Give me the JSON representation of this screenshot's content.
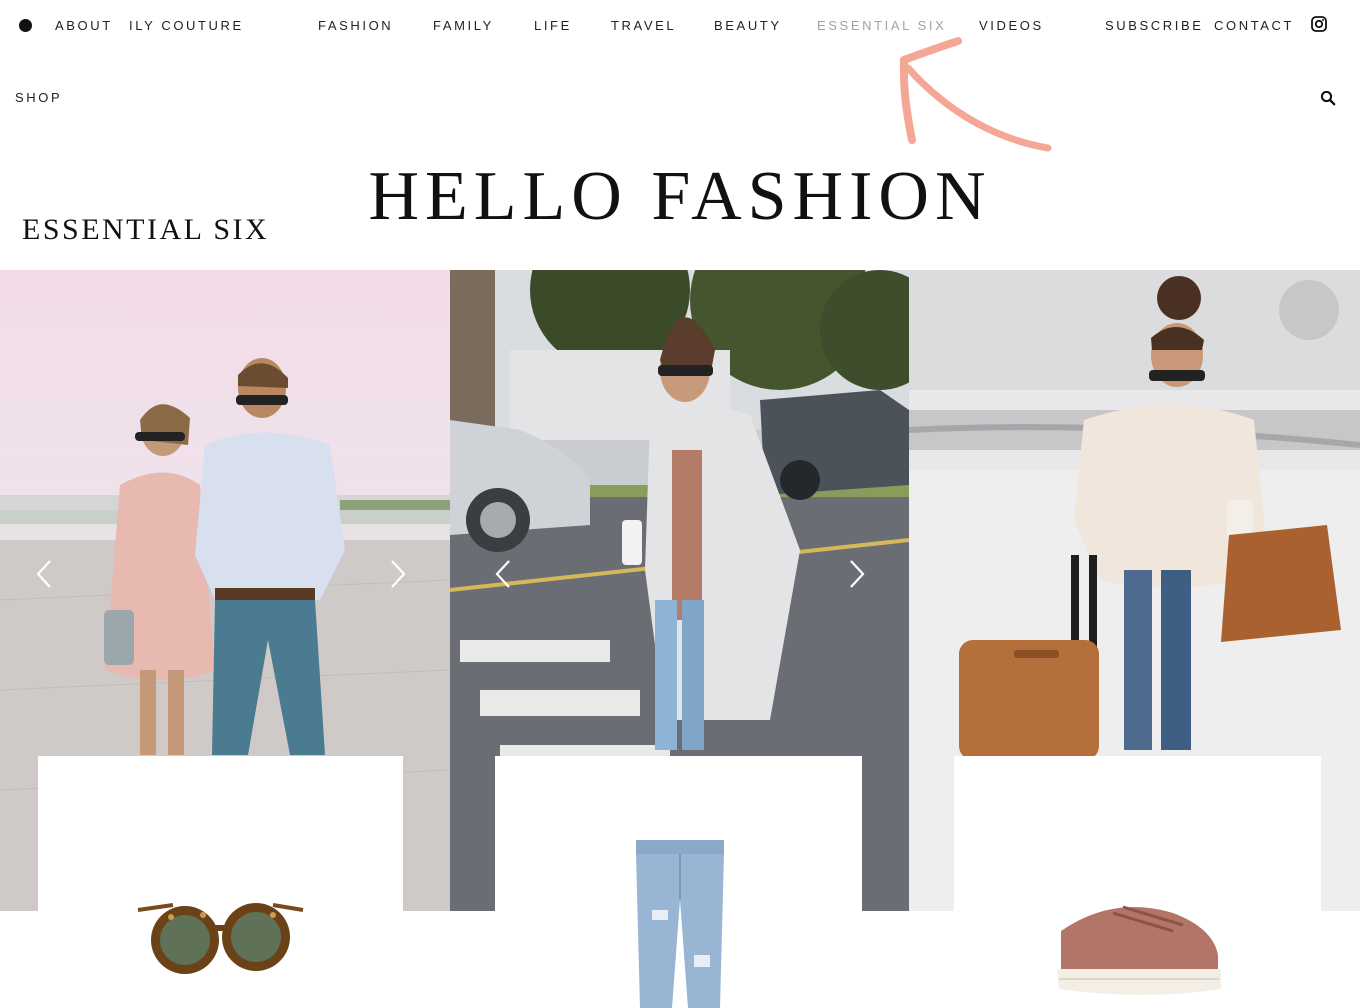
{
  "nav": {
    "left": [
      "ABOUT",
      "ILY COUTURE"
    ],
    "center": [
      "FASHION",
      "FAMILY",
      "LIFE",
      "TRAVEL",
      "BEAUTY",
      "ESSENTIAL SIX",
      "VIDEOS"
    ],
    "right": [
      "SUBSCRIBE",
      "CONTACT"
    ],
    "active": "ESSENTIAL SIX",
    "icons": [
      "logo-dot-icon",
      "instagram-icon"
    ]
  },
  "subnav": {
    "shop": "SHOP",
    "search_icon": "search-icon"
  },
  "brand": {
    "title": "HELLO FASHION"
  },
  "section": {
    "title": "ESSENTIAL SIX"
  },
  "annotation": {
    "icon": "pink-arrow-icon",
    "color": "#f4a795"
  },
  "gallery": {
    "panels": [
      "couple-outfit-photo",
      "street-cardigan-photo",
      "snow-travel-photo"
    ],
    "prev_icon": "chevron-left-icon",
    "next_icon": "chevron-right-icon"
  },
  "products": [
    "tortoise-sunglasses",
    "distressed-jeans",
    "pink-velvet-sneaker"
  ],
  "colors": {
    "nav_text": "#222222",
    "active_nav": "#a3a3a3",
    "accent_arrow": "#f4a795"
  }
}
